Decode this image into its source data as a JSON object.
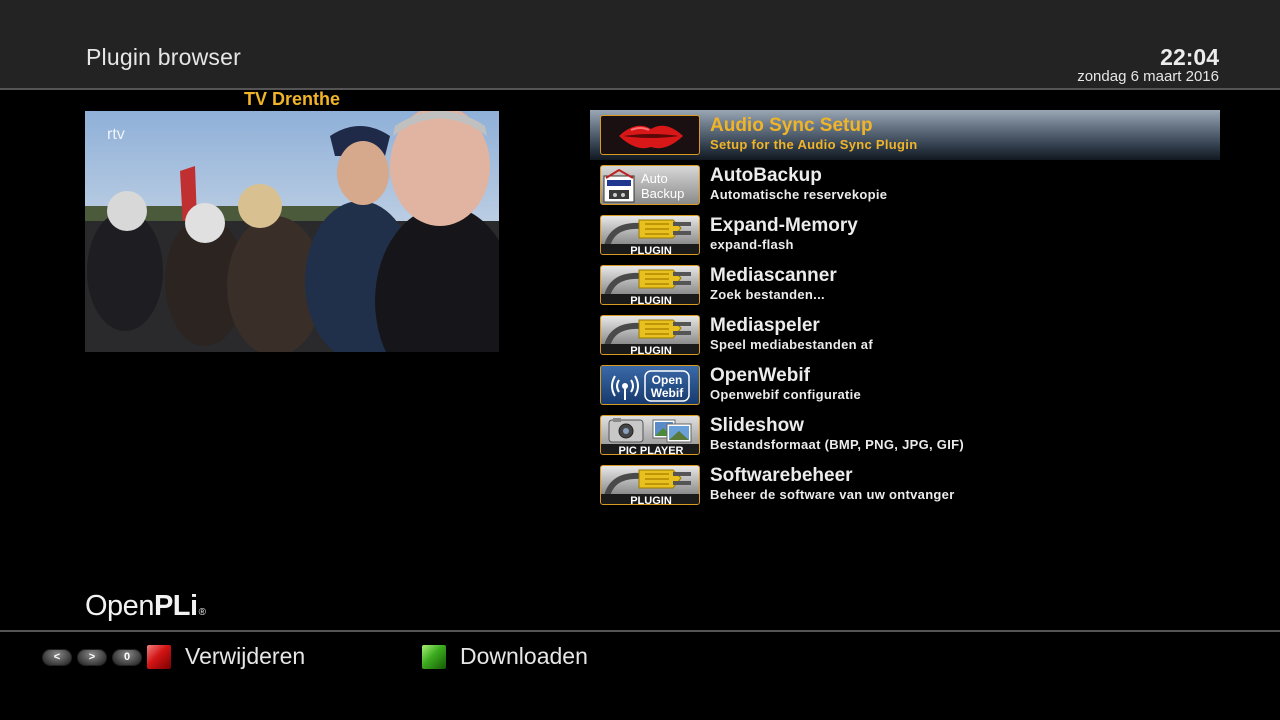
{
  "header": {
    "title": "Plugin browser",
    "time": "22:04",
    "date": "zondag  6 maart 2016"
  },
  "preview": {
    "channel": "TV Drenthe",
    "logo_text": "rtv"
  },
  "plugins": [
    {
      "name": "Audio Sync Setup",
      "description": "Setup for the Audio Sync Plugin",
      "icon": "lips-icon",
      "selected": true
    },
    {
      "name": "AutoBackup",
      "description": "Automatische reservekopie",
      "icon": "auto-backup-icon",
      "icon_text": [
        "Auto",
        "Backup"
      ]
    },
    {
      "name": "Expand-Memory",
      "description": "expand-flash",
      "icon": "plugin-cable-icon",
      "icon_text": "PLUGIN"
    },
    {
      "name": "Mediascanner",
      "description": "Zoek bestanden...",
      "icon": "plugin-cable-icon",
      "icon_text": "PLUGIN"
    },
    {
      "name": "Mediaspeler",
      "description": "Speel mediabestanden af",
      "icon": "plugin-cable-icon",
      "icon_text": "PLUGIN"
    },
    {
      "name": "OpenWebif",
      "description": "Openwebif configuratie",
      "icon": "openwebif-icon",
      "icon_text": [
        "Open",
        "Webif"
      ]
    },
    {
      "name": "Slideshow",
      "description": "Bestandsformaat (BMP, PNG, JPG, GIF)",
      "icon": "pic-player-icon",
      "icon_text": "PIC PLAYER"
    },
    {
      "name": "Softwarebeheer",
      "description": "Beheer de software van uw ontvanger",
      "icon": "plugin-cable-icon",
      "icon_text": "PLUGIN"
    }
  ],
  "branding": {
    "logo_light": "Open",
    "logo_bold": "PLi",
    "logo_mark": "®"
  },
  "footer": {
    "nav_keys": [
      "<",
      ">",
      "0"
    ],
    "red_label": "Verwijderen",
    "green_label": "Downloaden"
  },
  "colors": {
    "accent": "#f0b428",
    "header_bg": "#232323",
    "background": "#000000",
    "red_key": "#d21414",
    "green_key": "#3caa1e"
  }
}
